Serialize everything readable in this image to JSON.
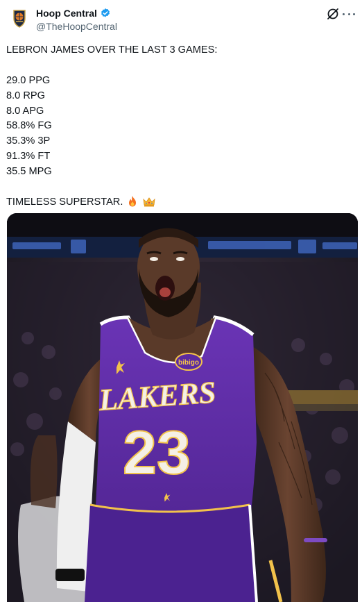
{
  "author": {
    "display_name": "Hoop Central",
    "handle": "@TheHoopCentral",
    "verified": true,
    "avatar_icon": "hoop-central-logo-icon"
  },
  "tweet": {
    "headline": "LEBRON JAMES OVER THE LAST 3 GAMES:",
    "stats": [
      "29.0 PPG",
      "8.0 RPG",
      "8.0 APG",
      "58.8% FG",
      "35.3% 3P",
      "91.3% FT",
      "35.5 MPG"
    ],
    "closing": "TIMELESS SUPERSTAR.",
    "closing_emojis": [
      "fire-emoji",
      "crown-emoji"
    ]
  },
  "media": {
    "jersey_team": "LAKERS",
    "jersey_number": "23",
    "patch_text": "bibigo",
    "colors": {
      "jersey": "#5b2ba1",
      "jersey_trim": "#ffffff",
      "lettering": "#f5f0e6",
      "gold": "#f2c24b",
      "skin": "#5a3a29"
    }
  },
  "icons": {
    "grok": "grok-icon",
    "more": "more-icon",
    "verified": "verified-badge-icon"
  },
  "colors": {
    "text": "#0f1419",
    "secondary": "#536471",
    "verified_blue": "#1d9bf0"
  }
}
